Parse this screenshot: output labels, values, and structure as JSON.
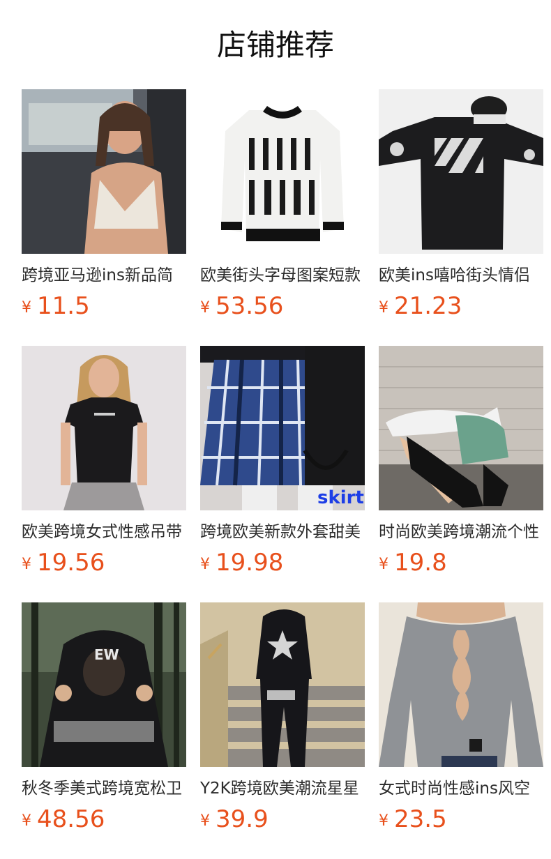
{
  "page": {
    "title": "店铺推荐"
  },
  "colors": {
    "price": "#e8501c",
    "text": "#2b2b2b"
  },
  "products": [
    {
      "name": "跨境亚马逊ins新品简",
      "currency": "¥",
      "price": "11.5",
      "image": "woman-in-white-crop-top-in-car"
    },
    {
      "name": "欧美街头字母图案短款",
      "currency": "¥",
      "price": "53.56",
      "image": "white-sweater-nuit-noire"
    },
    {
      "name": "欧美ins嘻哈街头情侣",
      "currency": "¥",
      "price": "21.23",
      "image": "black-long-sleeve-tee-with-cap"
    },
    {
      "name": "欧美跨境女式性感吊带",
      "currency": "¥",
      "price": "19.56",
      "image": "woman-black-fitted-tee"
    },
    {
      "name": "跨境欧美新款外套甜美",
      "currency": "¥",
      "price": "19.98",
      "image": "blue-plaid-pleated-skirt",
      "overlay_text": "skirt"
    },
    {
      "name": "时尚欧美跨境潮流个性",
      "currency": "¥",
      "price": "19.8",
      "image": "woman-green-print-skirt-boots"
    },
    {
      "name": "秋冬季美式跨境宽松卫",
      "currency": "¥",
      "price": "48.56",
      "image": "black-graphic-hoodie-forest"
    },
    {
      "name": "Y2K跨境欧美潮流星星",
      "currency": "¥",
      "price": "39.9",
      "image": "black-star-tracksuit-stairs"
    },
    {
      "name": "女式时尚性感ins风空",
      "currency": "¥",
      "price": "23.5",
      "image": "grey-cutout-long-sleeve-top"
    }
  ]
}
